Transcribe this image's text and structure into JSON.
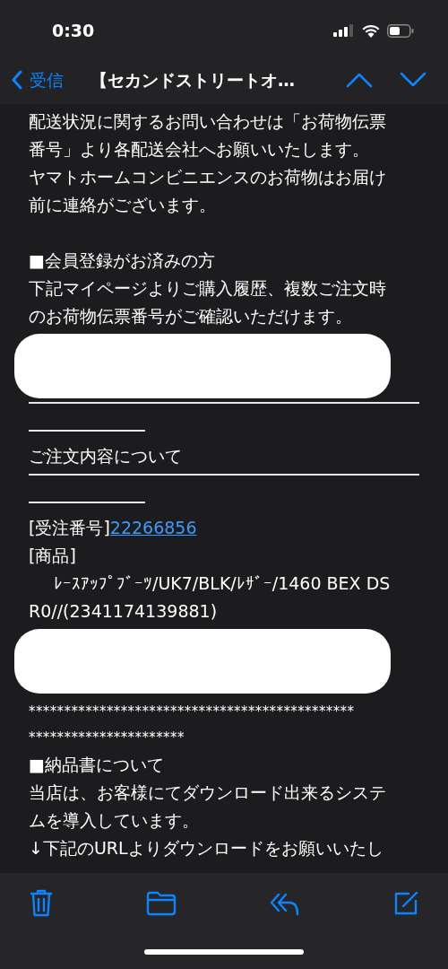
{
  "status_bar": {
    "time": "0:30"
  },
  "nav": {
    "back_label": "受信",
    "title": "【セカンドストリートオ…"
  },
  "body": [
    {
      "kind": "paragraph",
      "lines": [
        "配送状況に関するお問い合わせは「お荷物伝票",
        "番号」より各配送会社へお願いいたします。",
        "ヤマトホームコンビニエンスのお荷物はお届け",
        "前に連絡がございます。"
      ]
    },
    {
      "kind": "blank"
    },
    {
      "kind": "heading",
      "text": "■会員登録がお済みの方"
    },
    {
      "kind": "paragraph",
      "lines": [
        "下記マイページよりご購入履歴、複数ご注文時",
        "のお荷物伝票番号がご確認いただけます。"
      ]
    },
    {
      "kind": "redaction"
    },
    {
      "kind": "rule"
    },
    {
      "kind": "paragraph",
      "lines": [
        "ご注文内容について"
      ]
    },
    {
      "kind": "rule"
    },
    {
      "kind": "order_number",
      "label": "[受注番号]",
      "link": "22266856"
    },
    {
      "kind": "paragraph",
      "lines": [
        "[商品]"
      ]
    },
    {
      "kind": "product",
      "lines": [
        "ﾚｰｽｱｯﾌﾟﾌﾞｰﾂ/UK7/BLK/ﾚｻﾞｰ/1460 BEX DS",
        "R0//(2341174139881)"
      ]
    },
    {
      "kind": "redaction"
    },
    {
      "kind": "separator",
      "lines": [
        "**********************************************",
        "**********************"
      ]
    },
    {
      "kind": "heading",
      "text": "■納品書について"
    },
    {
      "kind": "paragraph",
      "lines": [
        "当店は、お客様にてダウンロード出来るシステ",
        "ムを導入しています。",
        "↓下記のURLよりダウンロードをお願いいたし"
      ]
    }
  ]
}
